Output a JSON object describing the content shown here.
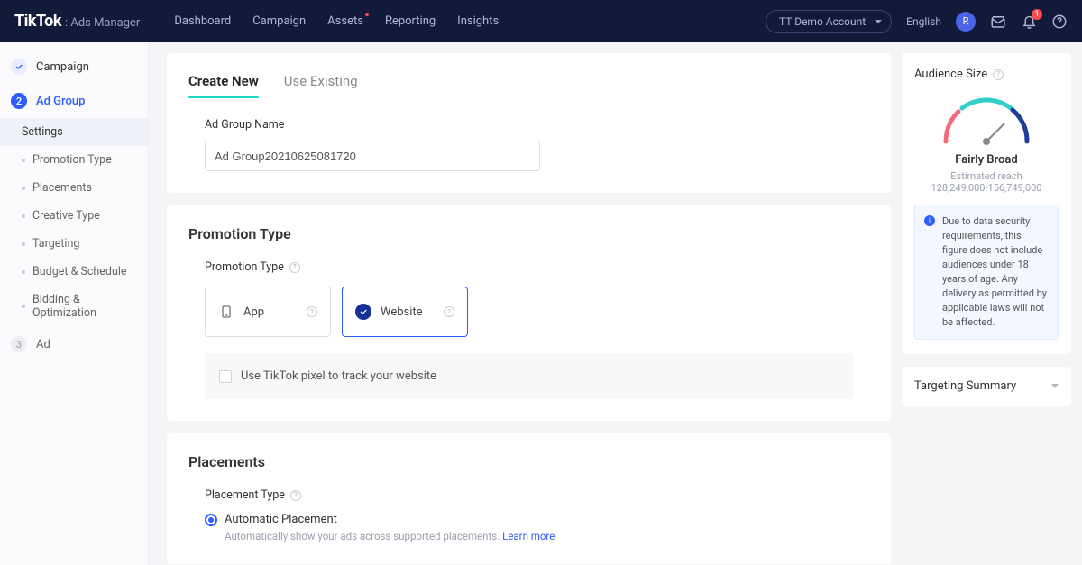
{
  "topnav": {
    "brand": "TikTok",
    "brand_sub": ": Ads Manager",
    "links": [
      "Dashboard",
      "Campaign",
      "Assets",
      "Reporting",
      "Insights"
    ],
    "account_label": "TT Demo Account",
    "language": "English",
    "avatar_initial": "R",
    "notif_badge": "1"
  },
  "sidebar": {
    "step1": "Campaign",
    "step2": "Ad Group",
    "step3": "Ad",
    "sub_items": [
      "Settings",
      "Promotion Type",
      "Placements",
      "Creative Type",
      "Targeting",
      "Budget & Schedule",
      "Bidding & Optimization"
    ]
  },
  "main": {
    "tabs": {
      "create": "Create New",
      "existing": "Use Existing"
    },
    "adgroup_name_label": "Ad Group Name",
    "adgroup_name_value": "Ad Group20210625081720",
    "promo_section_title": "Promotion Type",
    "promo_field_label": "Promotion Type",
    "promo_app": "App",
    "promo_website": "Website",
    "pixel_checkbox": "Use TikTok pixel to track your website",
    "placements_title": "Placements",
    "placement_type_label": "Placement Type",
    "auto_placement": "Automatic Placement",
    "auto_placement_hint": "Automatically show your ads across supported placements.",
    "learn_more": "Learn more"
  },
  "rail": {
    "audience_title": "Audience Size",
    "audience_status": "Fairly Broad",
    "audience_sub": "Estimated reach",
    "audience_range": "128,249,000-156,749,000",
    "notice": "Due to data security requirements, this figure does not include audiences under 18 years of age. Any delivery as permitted by applicable laws will not be affected.",
    "targeting_summary": "Targeting Summary"
  }
}
